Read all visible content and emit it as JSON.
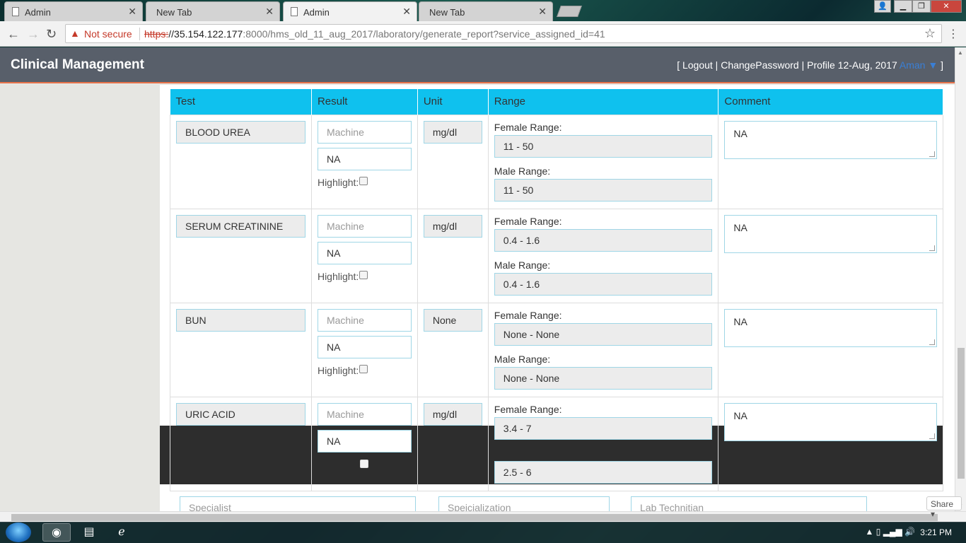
{
  "browser": {
    "tabs": [
      {
        "title": "Admin",
        "active": false,
        "icon": "document-icon"
      },
      {
        "title": "New Tab",
        "active": false,
        "icon": ""
      },
      {
        "title": "Admin",
        "active": true,
        "icon": "document-icon"
      },
      {
        "title": "New Tab",
        "active": false,
        "icon": ""
      }
    ],
    "security_label": "Not secure",
    "url_scheme": "https:",
    "url_host": "//35.154.122.177",
    "url_rest": ":8000/hms_old_11_aug_2017/laboratory/generate_report?service_assigned_id=41"
  },
  "header": {
    "title": "Clinical Management",
    "user_prefix": "[ Logout | ChangePassword | Profile 12-Aug, 2017 ",
    "user_name": "Aman",
    "user_suffix": " ]"
  },
  "table": {
    "columns": [
      "Test",
      "Result",
      "Unit",
      "Range",
      "Comment"
    ],
    "machine_placeholder": "Machine",
    "highlight_label": "Highlight:",
    "female_label": "Female Range:",
    "male_label": "Male Range:",
    "rows": [
      {
        "test": "BLOOD UREA",
        "result": "NA",
        "unit": "mg/dl",
        "female": "11 - 50",
        "male": "11 - 50",
        "comment": "NA"
      },
      {
        "test": "SERUM CREATININE",
        "result": "NA",
        "unit": "mg/dl",
        "female": "0.4 - 1.6",
        "male": "0.4 - 1.6",
        "comment": "NA"
      },
      {
        "test": "BUN",
        "result": "NA",
        "unit": "None",
        "female": "None - None",
        "male": "None - None",
        "comment": "NA"
      },
      {
        "test": "URIC ACID",
        "result": "NA",
        "unit": "mg/dl",
        "female": "3.4 - 7",
        "male": "2.5 - 6",
        "comment": "NA"
      }
    ]
  },
  "footer": {
    "specialist_placeholder": "Specialist",
    "specialization_placeholder": "Speicialization",
    "lab_technician_placeholder": "Lab Technitian"
  },
  "share_label": "Share",
  "taskbar": {
    "time": "3:21 PM"
  }
}
